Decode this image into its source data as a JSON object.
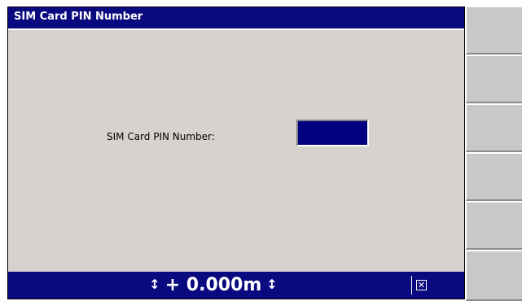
{
  "window": {
    "title": "SIM Card PIN Number"
  },
  "form": {
    "pin_label": "SIM Card PIN Number:",
    "pin_value": ""
  },
  "status": {
    "height_value": "+ 0.000m",
    "updown_glyph": "↕",
    "close_glyph": "✕"
  },
  "softkeys": [
    "",
    "",
    "",
    "",
    "",
    ""
  ]
}
